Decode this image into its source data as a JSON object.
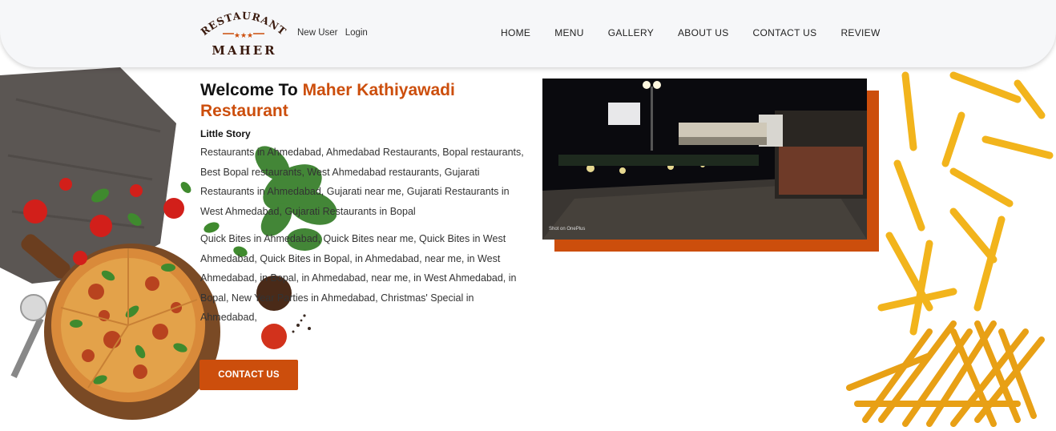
{
  "header": {
    "logo": {
      "top_text": "RESTAURANT",
      "bottom_text": "MAHER"
    },
    "auth": {
      "new_user": "New User",
      "login": "Login"
    },
    "nav": [
      "HOME",
      "MENU",
      "GALLERY",
      "ABOUT US",
      "CONTACT US",
      "REVIEW"
    ]
  },
  "main": {
    "title_prefix": "Welcome To ",
    "title_accent": "Maher Kathiyawadi Restaurant",
    "subtitle": "Little Story",
    "paragraph_1": "Restaurants in Ahmedabad, Ahmedabad Restaurants, Bopal restaurants, Best Bopal restaurants, West Ahmedabad restaurants, Gujarati Restaurants in Ahmedabad, Gujarati near me, Gujarati Restaurants in West Ahmedabad, Gujarati Restaurants in Bopal",
    "paragraph_2": "Quick Bites in Ahmedabad, Quick Bites near me, Quick Bites in West Ahmedabad, Quick Bites in Bopal, in Ahmedabad, near me, in West Ahmedabad, in Bopal, in Ahmedabad, near me, in West Ahmedabad, in Bopal, New Year Parties in Ahmedabad, Christmas' Special in Ahmedabad,",
    "cta_label": "CONTACT US"
  },
  "photo": {
    "watermark": "Shot on OnePlus"
  },
  "colors": {
    "accent": "#cc4e0c",
    "header_bg": "#f6f7f9",
    "text": "#222222"
  },
  "icons": [
    "pizza-image",
    "fries-image",
    "basil-image",
    "restaurant-photo"
  ]
}
